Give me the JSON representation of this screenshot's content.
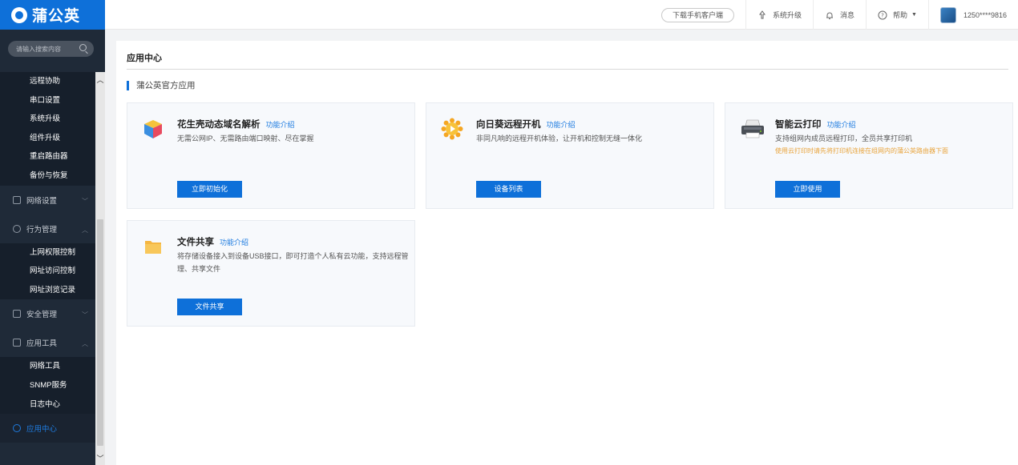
{
  "app": {
    "logo_text": "蒲公英"
  },
  "topbar": {
    "download_label": "下载手机客户端",
    "upgrade_label": "系统升级",
    "messages_label": "消息",
    "help_label": "帮助",
    "account_label": "1250****9816"
  },
  "sidebar": {
    "search_placeholder": "请输入搜索内容",
    "group_system_items": [
      "远程协助",
      "串口设置",
      "系统升级",
      "组件升级",
      "重启路由器",
      "备份与恢复"
    ],
    "groups": {
      "network": "网络设置",
      "behavior": "行为管理",
      "security": "安全管理",
      "tools": "应用工具",
      "app_center": "应用中心"
    },
    "behavior_items": [
      "上网权限控制",
      "网址访问控制",
      "网址浏览记录"
    ],
    "tools_items": [
      "网络工具",
      "SNMP服务",
      "日志中心"
    ]
  },
  "main": {
    "page_title": "应用中心",
    "section_title": "蒲公英官方应用",
    "cards": [
      {
        "title": "花生壳动态域名解析",
        "link": "功能介绍",
        "desc": "无需公网IP、无需路由端口映射、尽在掌握",
        "note": "",
        "button": "立即初始化",
        "icon": "cube-icon"
      },
      {
        "title": "向日葵远程开机",
        "link": "功能介绍",
        "desc": "非同凡响的远程开机体验，让开机和控制无缝一体化",
        "note": "",
        "button": "设备列表",
        "icon": "sunflower-icon"
      },
      {
        "title": "智能云打印",
        "link": "功能介绍",
        "desc": "支持组网内成员远程打印，全员共享打印机",
        "note": "使用云打印时请先将打印机连接在组网内的蒲公英路由器下面",
        "button": "立即使用",
        "icon": "printer-icon"
      },
      {
        "title": "文件共享",
        "link": "功能介绍",
        "desc": "将存储设备接入到设备USB接口，即可打造个人私有云功能，支持远程管理、共享文件",
        "note": "",
        "button": "文件共享",
        "icon": "folder-icon"
      }
    ]
  },
  "colors": {
    "brand": "#0e70d9",
    "sidebar_bg": "#1f2a38",
    "note": "#e8a33a"
  }
}
